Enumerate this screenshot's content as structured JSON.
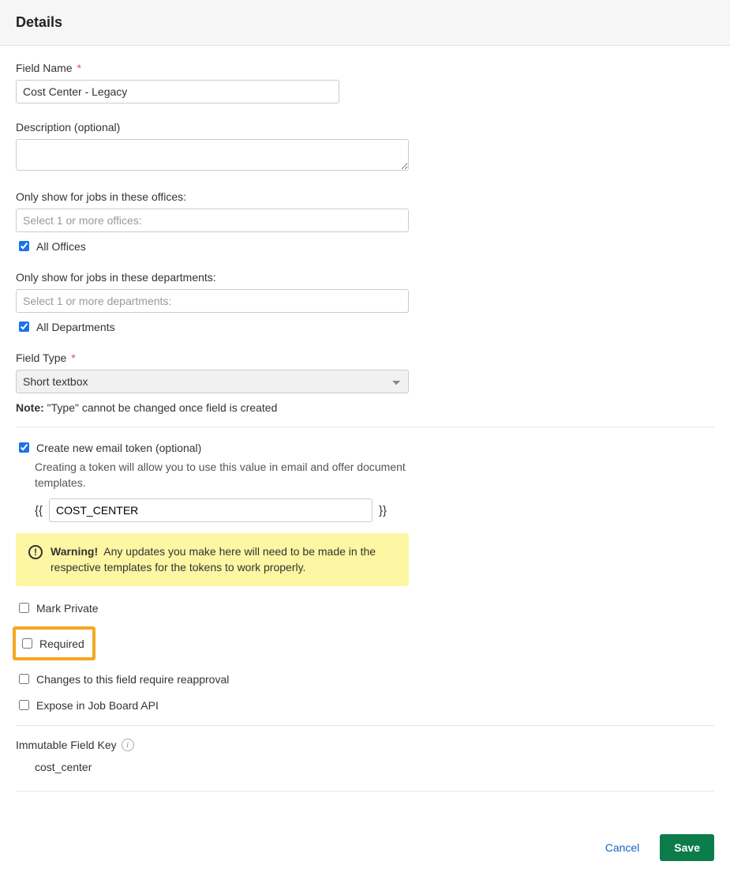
{
  "header": {
    "title": "Details"
  },
  "fieldName": {
    "label": "Field Name",
    "required_marker": "*",
    "value": "Cost Center - Legacy"
  },
  "description": {
    "label": "Description (optional)",
    "value": ""
  },
  "offices": {
    "label": "Only show for jobs in these offices:",
    "placeholder": "Select 1 or more offices:",
    "all_label": "All Offices",
    "all_checked": true
  },
  "departments": {
    "label": "Only show for jobs in these departments:",
    "placeholder": "Select 1 or more departments:",
    "all_label": "All Departments",
    "all_checked": true
  },
  "fieldType": {
    "label": "Field Type",
    "required_marker": "*",
    "value": "Short textbox"
  },
  "note": {
    "bold": "Note:",
    "text": "\"Type\" cannot be changed once field is created"
  },
  "token": {
    "checkbox_label": "Create new email token (optional)",
    "checked": true,
    "hint": "Creating a token will allow you to use this value in email and offer document templates.",
    "open": "{{",
    "close": "}}",
    "value": "COST_CENTER"
  },
  "warning": {
    "title": "Warning!",
    "text": "Any updates you make here will need to be made in the respective templates for the tokens to work properly."
  },
  "options": {
    "mark_private": {
      "label": "Mark Private",
      "checked": false
    },
    "required": {
      "label": "Required",
      "checked": false
    },
    "reapproval": {
      "label": "Changes to this field require reapproval",
      "checked": false
    },
    "expose_api": {
      "label": "Expose in Job Board API",
      "checked": false
    }
  },
  "immutable": {
    "label": "Immutable Field Key",
    "value": "cost_center"
  },
  "footer": {
    "cancel": "Cancel",
    "save": "Save"
  }
}
